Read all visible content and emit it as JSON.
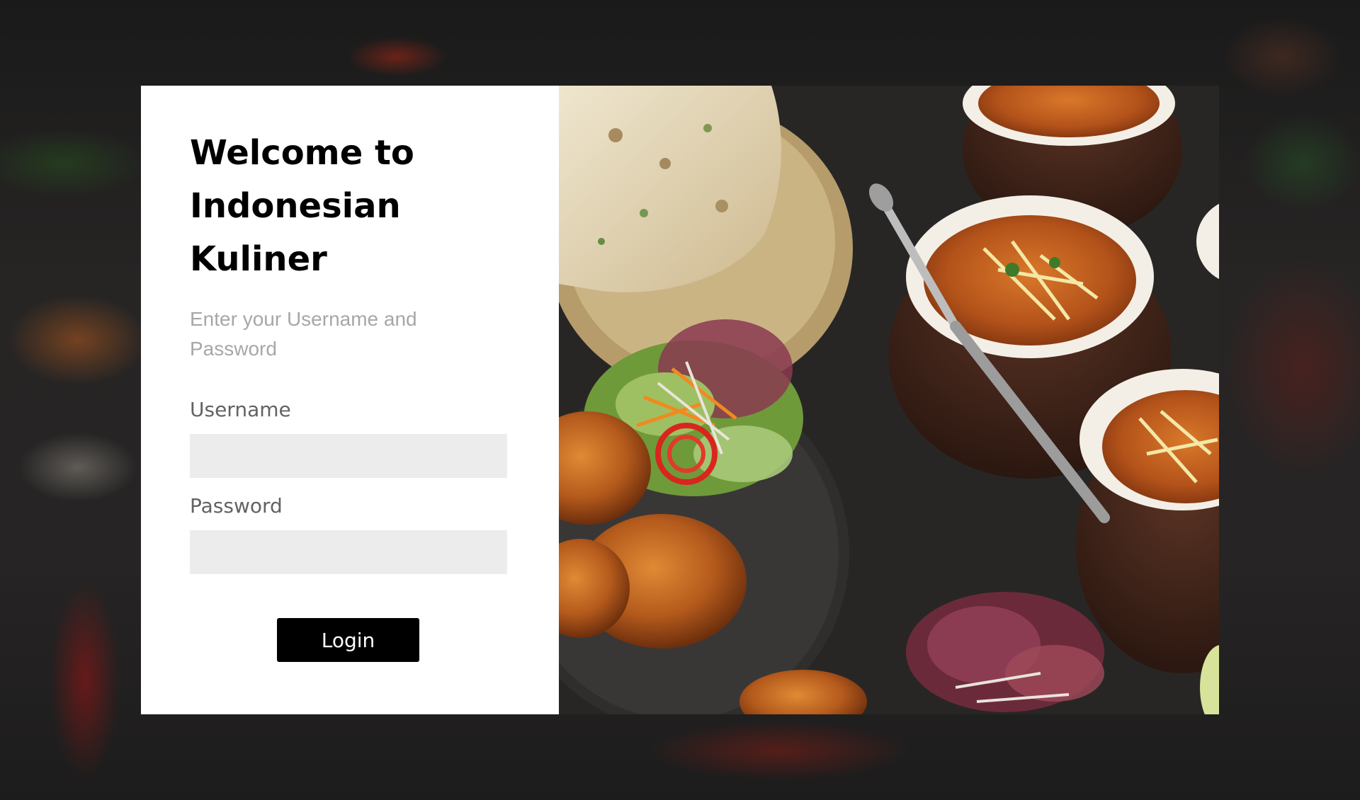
{
  "login_panel": {
    "title": "Welcome to Indonesian Kuliner",
    "subtitle": "Enter your Username and Password",
    "username_label": "Username",
    "username_value": "",
    "password_label": "Password",
    "password_value": "",
    "login_button": "Login"
  },
  "photo": {
    "image_name": "food-photo",
    "background_image_name": "food-background"
  },
  "colors": {
    "panel_bg": "#ffffff",
    "field_bg": "#ececec",
    "button_bg": "#000000",
    "label_color": "#626262",
    "subtitle_color": "#a7a7a7"
  }
}
